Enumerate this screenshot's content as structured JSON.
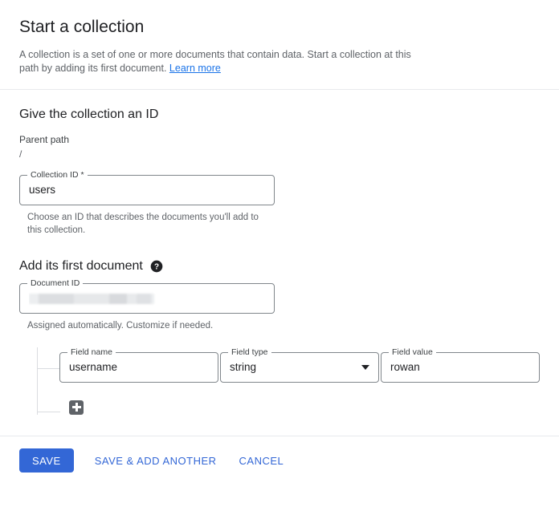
{
  "header": {
    "title": "Start a collection",
    "description_part1": "A collection is a set of one or more documents that contain data. Start a collection at this path by adding its first document.",
    "learn_more_label": "Learn more"
  },
  "collection_section": {
    "title": "Give the collection an ID",
    "parent_path_label": "Parent path",
    "parent_path_value": "/",
    "collection_id_legend": "Collection ID *",
    "collection_id_value": "users",
    "collection_id_helper": "Choose an ID that describes the documents you'll add to this collection."
  },
  "document_section": {
    "title": "Add its first document",
    "help_icon": "help-icon",
    "document_id_legend": "Document ID",
    "document_id_value": "",
    "document_id_helper": "Assigned automatically. Customize if needed."
  },
  "field_row": {
    "field_name_legend": "Field name",
    "field_name_value": "username",
    "field_type_legend": "Field type",
    "field_type_value": "string",
    "field_type_caret": "chevron-down-icon",
    "field_value_legend": "Field value",
    "field_value_value": "rowan",
    "add_field_icon": "plus-icon"
  },
  "footer": {
    "save_label": "SAVE",
    "save_add_another_label": "SAVE & ADD ANOTHER",
    "cancel_label": "CANCEL"
  },
  "colors": {
    "accent_blue": "#3367d6",
    "link_blue": "#1a73e8",
    "text_primary": "#202124",
    "text_secondary": "#5f6368",
    "border": "#80868b",
    "divider": "#e8eaed"
  }
}
